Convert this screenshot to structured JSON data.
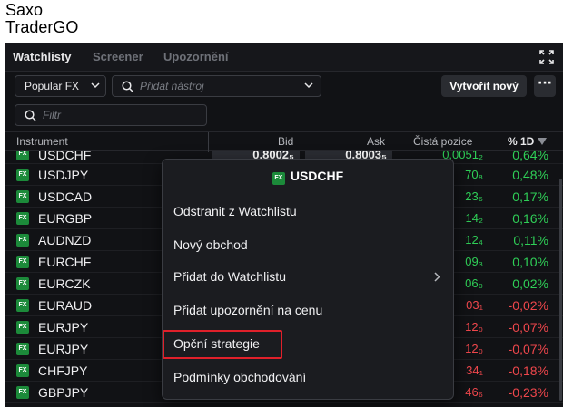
{
  "app": {
    "title_line1": "Saxo",
    "title_line2": "TraderGO"
  },
  "tabs": [
    {
      "label": "Watchlisty",
      "active": true
    },
    {
      "label": "Screener"
    },
    {
      "label": "Upozornění"
    }
  ],
  "toolbar": {
    "list_select": "Popular FX",
    "search_placeholder": "Přidat nástroj",
    "new_button": "Vytvořit nový",
    "more_button": "···"
  },
  "filter": {
    "placeholder": "Filtr"
  },
  "columns": {
    "instrument": "Instrument",
    "bid": "Bid",
    "ask": "Ask",
    "net": "Čistá pozice",
    "pct": "% 1D"
  },
  "badge_label": "FX",
  "rows": [
    {
      "symbol": "USDCHF",
      "bid": "0,8002₅",
      "ask": "0,8003₅",
      "net": "0,0051₂",
      "pct": "0,64%",
      "dir": "up"
    },
    {
      "symbol": "USDJPY",
      "net": "70₈",
      "pct": "0,48%",
      "dir": "up"
    },
    {
      "symbol": "USDCAD",
      "net": "23₆",
      "pct": "0,17%",
      "dir": "up"
    },
    {
      "symbol": "EURGBP",
      "net": "14₂",
      "pct": "0,16%",
      "dir": "up"
    },
    {
      "symbol": "AUDNZD",
      "net": "12₄",
      "pct": "0,11%",
      "dir": "up"
    },
    {
      "symbol": "EURCHF",
      "net": "09₃",
      "pct": "0,10%",
      "dir": "up"
    },
    {
      "symbol": "EURCZK",
      "net": "06₀",
      "pct": "0,02%",
      "dir": "up"
    },
    {
      "symbol": "EURAUD",
      "net": "03₁",
      "pct": "-0,02%",
      "dir": "down"
    },
    {
      "symbol": "EURJPY",
      "net": "12₀",
      "pct": "-0,07%",
      "dir": "down"
    },
    {
      "symbol": "EURJPY",
      "net": "12₀",
      "pct": "-0,07%",
      "dir": "down"
    },
    {
      "symbol": "CHFJPY",
      "net": "34₁",
      "pct": "-0,18%",
      "dir": "down"
    },
    {
      "symbol": "GBPJPY",
      "net": "46₆",
      "pct": "-0,23%",
      "dir": "down"
    }
  ],
  "context_menu": {
    "title": "USDCHF",
    "items": [
      "Odstranit z Watchlistu",
      "Nový obchod",
      "Přidat do Watchlistu",
      "Přidat upozornění na cenu",
      "Opční strategie",
      "Podmínky obchodování"
    ],
    "highlighted_index": 4
  },
  "colors": {
    "up": "#2fcf57",
    "down": "#f0474c",
    "fx_badge": "#1c8a3a",
    "highlight": "#e0202a"
  }
}
